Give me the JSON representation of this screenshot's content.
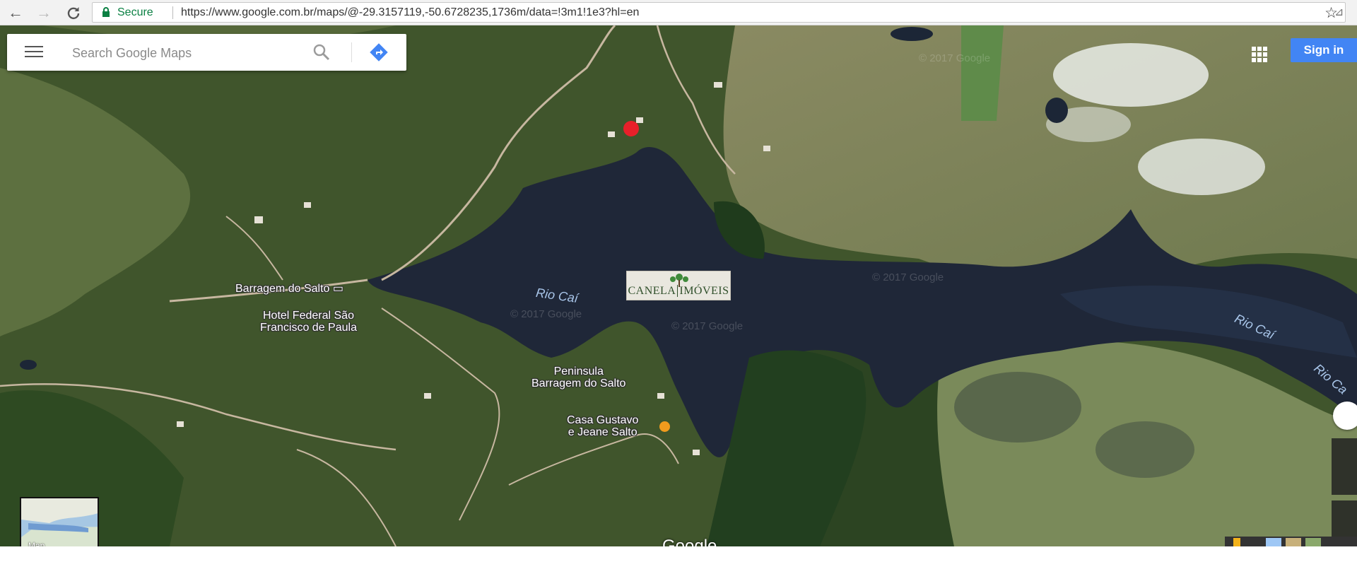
{
  "browser": {
    "secure_label": "Secure",
    "url": "https://www.google.com.br/maps/@-29.3157119,-50.6728235,1736m/data=!3m1!1e3?hl=en",
    "icons": [
      "back-icon",
      "forward-icon",
      "reload-icon",
      "lock-icon",
      "star-icon",
      "extension-icon"
    ]
  },
  "search": {
    "placeholder": "Search Google Maps",
    "icons": [
      "menu-icon",
      "search-icon",
      "directions-icon"
    ]
  },
  "header": {
    "signin_label": "Sign in",
    "apps_icon": "apps-grid-icon"
  },
  "map": {
    "places": {
      "barragem": "Barragem do Salto",
      "hotel_line1": "Hotel Federal São",
      "hotel_line2": "Francisco de Paula",
      "peninsula_line1": "Peninsula",
      "peninsula_line2": "Barragem do Salto",
      "casa_line1": "Casa Gustavo",
      "casa_line2": "e Jeane Salto"
    },
    "water": {
      "rio1": "Rio Caí",
      "rio2": "Rio Caí",
      "rio3": "Rio Ca"
    },
    "watermark": "© 2017 Google",
    "minimap_label": "Map",
    "google_logo": "Google",
    "pin_color": "#e8202a"
  },
  "overlay_logo": {
    "left": "CANELA",
    "right": "IMÓVEIS"
  },
  "colors": {
    "signin": "#4285f4",
    "secure": "#0b8043",
    "water": "#1f2738"
  }
}
